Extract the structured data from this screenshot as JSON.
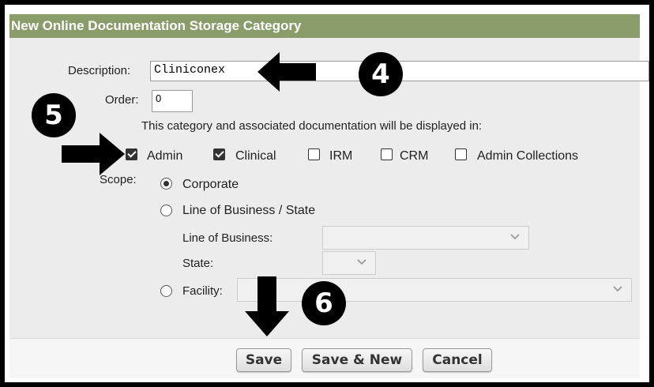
{
  "dialog": {
    "title": "New Online Documentation Storage Category"
  },
  "form": {
    "description_label": "Description:",
    "description_value": "Cliniconex",
    "order_label": "Order:",
    "order_value": "0",
    "display_text": "This category and associated documentation will be displayed in:",
    "checkboxes": [
      {
        "label": "Admin",
        "checked": true
      },
      {
        "label": "Clinical",
        "checked": true
      },
      {
        "label": "IRM",
        "checked": false
      },
      {
        "label": "CRM",
        "checked": false
      },
      {
        "label": "Admin Collections",
        "checked": false
      }
    ],
    "scope_label": "Scope:",
    "scope_options": [
      {
        "label": "Corporate",
        "selected": true
      },
      {
        "label": "Line of Business / State",
        "selected": false
      },
      {
        "label": "Facility:",
        "selected": false
      }
    ],
    "line_of_business_label": "Line of Business:",
    "line_of_business_value": "",
    "state_label": "State:",
    "state_value": "",
    "facility_value": ""
  },
  "buttons": {
    "save": "Save",
    "save_new": "Save & New",
    "cancel": "Cancel"
  },
  "annotations": {
    "step4": "4",
    "step5": "5",
    "step6": "6"
  }
}
